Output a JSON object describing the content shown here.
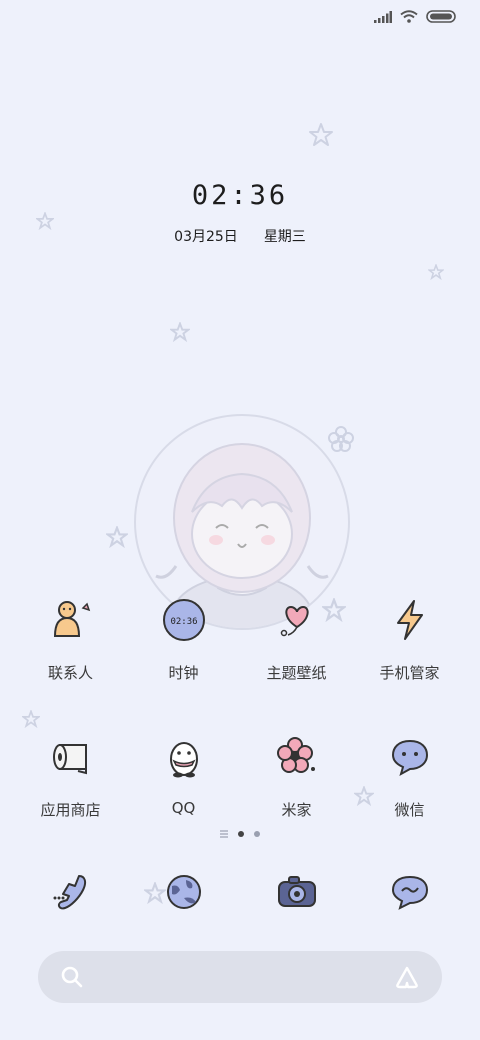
{
  "lock": {
    "time": "02:36",
    "date": "03月25日",
    "weekday": "星期三"
  },
  "widget": {
    "clock_icon_time": "02:36"
  },
  "apps": [
    {
      "label": "联系人",
      "icon": "snowman-contacts-icon"
    },
    {
      "label": "时钟",
      "icon": "clock-icon"
    },
    {
      "label": "主题壁纸",
      "icon": "heart-balloon-icon"
    },
    {
      "label": "手机管家",
      "icon": "lightning-icon"
    },
    {
      "label": "应用商店",
      "icon": "paper-roll-icon"
    },
    {
      "label": "QQ",
      "icon": "penguin-icon"
    },
    {
      "label": "米家",
      "icon": "flower-icon"
    },
    {
      "label": "微信",
      "icon": "chat-bubble-icon"
    }
  ],
  "dock": [
    {
      "icon": "phone-icon"
    },
    {
      "icon": "globe-icon"
    },
    {
      "icon": "camera-icon"
    },
    {
      "icon": "message-icon"
    }
  ],
  "colors": {
    "background": "#eef1fb",
    "accent": "#aab6e8",
    "search_bg": "#dde0ea"
  }
}
